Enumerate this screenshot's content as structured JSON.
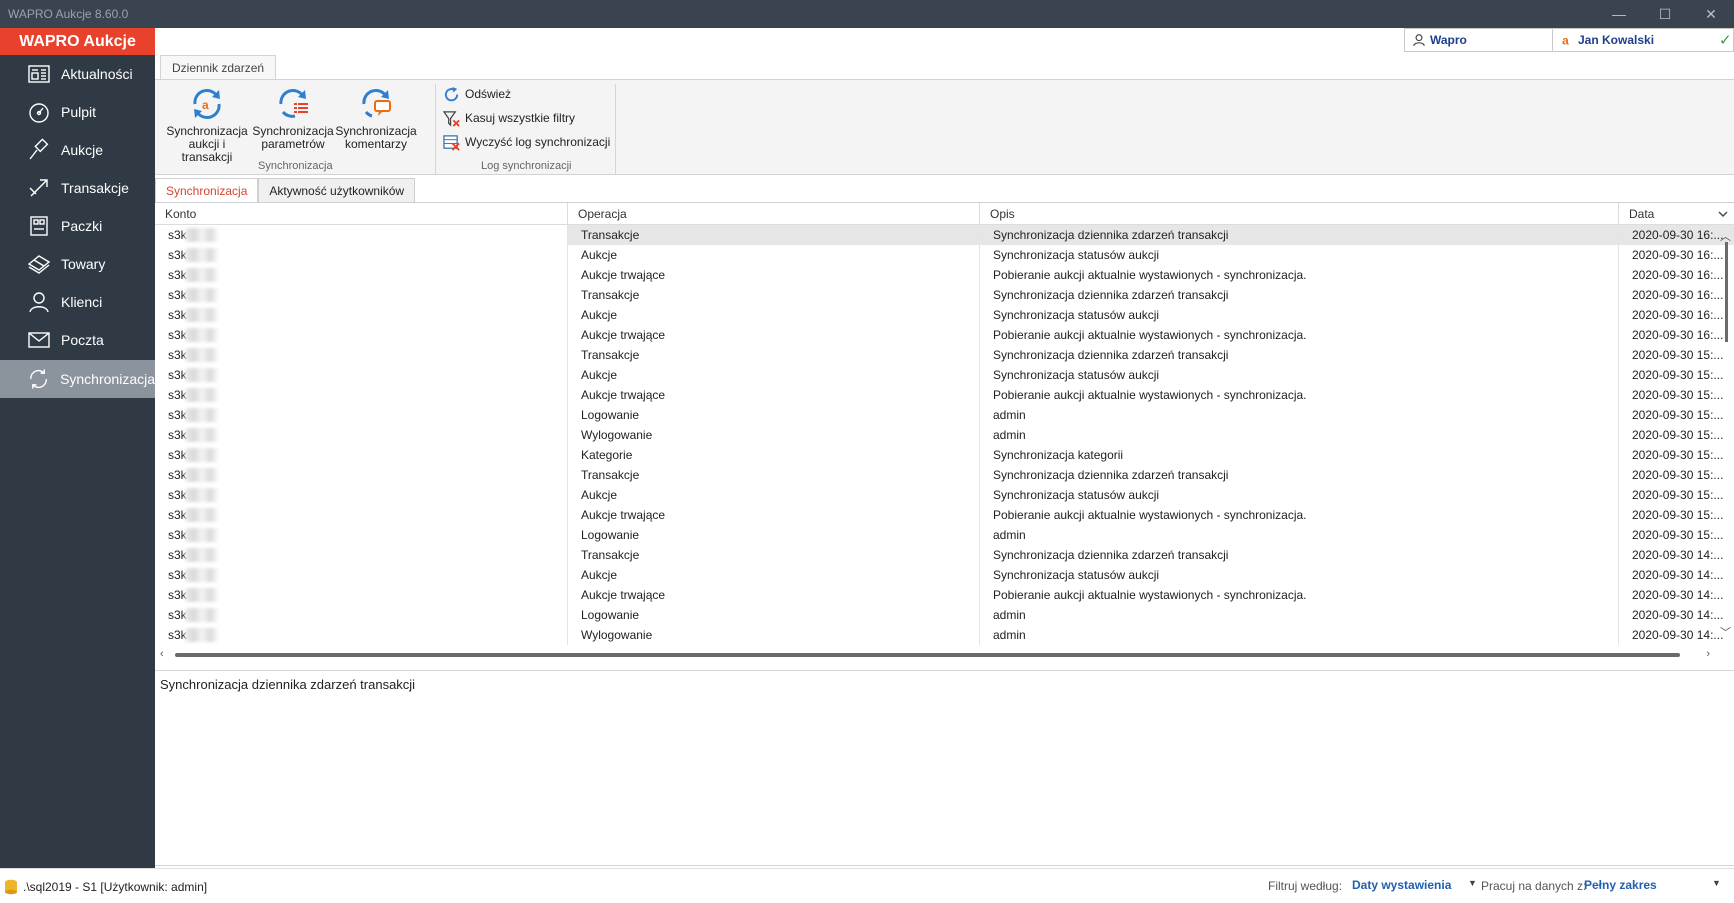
{
  "window": {
    "title": "WAPRO Aukcje 8.60.0",
    "minimize": "—",
    "maximize": "☐",
    "close": "✕"
  },
  "sidebar": {
    "brand": "WAPRO Aukcje",
    "items": [
      {
        "label": "Aktualności",
        "icon": "news-icon"
      },
      {
        "label": "Pulpit",
        "icon": "dashboard-icon"
      },
      {
        "label": "Aukcje",
        "icon": "gavel-icon"
      },
      {
        "label": "Transakcje",
        "icon": "transfer-icon"
      },
      {
        "label": "Paczki",
        "icon": "package-icon"
      },
      {
        "label": "Towary",
        "icon": "goods-icon"
      },
      {
        "label": "Klienci",
        "icon": "user-icon"
      },
      {
        "label": "Poczta",
        "icon": "mail-icon"
      },
      {
        "label": "Synchronizacja",
        "icon": "sync-icon",
        "active": true
      }
    ]
  },
  "userbar": {
    "company": "Wapro",
    "user": "Jan Kowalski",
    "status": "✓"
  },
  "ribbon": {
    "tab": "Dziennik zdarzeń",
    "groups": {
      "sync": {
        "label": "Synchronizacja",
        "buttons": [
          {
            "line1": "Synchronizacja",
            "line2": "aukcji i transakcji"
          },
          {
            "line1": "Synchronizacja",
            "line2": "parametrów"
          },
          {
            "line1": "Synchronizacja",
            "line2": "komentarzy"
          }
        ]
      },
      "log": {
        "label": "Log synchronizacji",
        "items": [
          "Odśwież",
          "Kasuj wszystkie filtry",
          "Wyczyść log synchronizacji"
        ]
      }
    }
  },
  "tabs": [
    "Synchronizacja",
    "Aktywność użytkowników"
  ],
  "grid": {
    "columns": [
      "Konto",
      "Operacja",
      "Opis",
      "Data"
    ],
    "rows": [
      [
        "s3k",
        "Transakcje",
        "Synchronizacja dziennika zdarzeń transakcji",
        "2020-09-30 16:..."
      ],
      [
        "s3k",
        "Aukcje",
        "Synchronizacja statusów aukcji",
        "2020-09-30 16:..."
      ],
      [
        "s3k",
        "Aukcje trwające",
        "Pobieranie aukcji aktualnie wystawionych - synchronizacja.",
        "2020-09-30 16:..."
      ],
      [
        "s3k",
        "Transakcje",
        "Synchronizacja dziennika zdarzeń transakcji",
        "2020-09-30 16:..."
      ],
      [
        "s3k",
        "Aukcje",
        "Synchronizacja statusów aukcji",
        "2020-09-30 16:..."
      ],
      [
        "s3k",
        "Aukcje trwające",
        "Pobieranie aukcji aktualnie wystawionych - synchronizacja.",
        "2020-09-30 16:..."
      ],
      [
        "s3k",
        "Transakcje",
        "Synchronizacja dziennika zdarzeń transakcji",
        "2020-09-30 15:..."
      ],
      [
        "s3k",
        "Aukcje",
        "Synchronizacja statusów aukcji",
        "2020-09-30 15:..."
      ],
      [
        "s3k",
        "Aukcje trwające",
        "Pobieranie aukcji aktualnie wystawionych - synchronizacja.",
        "2020-09-30 15:..."
      ],
      [
        "s3k",
        "Logowanie",
        "admin",
        "2020-09-30 15:..."
      ],
      [
        "s3k",
        "Wylogowanie",
        "admin",
        "2020-09-30 15:..."
      ],
      [
        "s3k",
        "Kategorie",
        "Synchronizacja kategorii",
        "2020-09-30 15:..."
      ],
      [
        "s3k",
        "Transakcje",
        "Synchronizacja dziennika zdarzeń transakcji",
        "2020-09-30 15:..."
      ],
      [
        "s3k",
        "Aukcje",
        "Synchronizacja statusów aukcji",
        "2020-09-30 15:..."
      ],
      [
        "s3k",
        "Aukcje trwające",
        "Pobieranie aukcji aktualnie wystawionych - synchronizacja.",
        "2020-09-30 15:..."
      ],
      [
        "s3k",
        "Logowanie",
        "admin",
        "2020-09-30 15:..."
      ],
      [
        "s3k",
        "Transakcje",
        "Synchronizacja dziennika zdarzeń transakcji",
        "2020-09-30 14:..."
      ],
      [
        "s3k",
        "Aukcje",
        "Synchronizacja statusów aukcji",
        "2020-09-30 14:..."
      ],
      [
        "s3k",
        "Aukcje trwające",
        "Pobieranie aukcji aktualnie wystawionych - synchronizacja.",
        "2020-09-30 14:..."
      ],
      [
        "s3k",
        "Logowanie",
        "admin",
        "2020-09-30 14:..."
      ],
      [
        "s3k",
        "Wylogowanie",
        "admin",
        "2020-09-30 14:..."
      ]
    ]
  },
  "detail": {
    "text": "Synchronizacja dziennika zdarzeń transakcji"
  },
  "statusbar": {
    "connection": ".\\sql2019 - S1 [Użytkownik: admin]",
    "filter_label": "Filtruj według:",
    "filter_value": "Daty wystawienia",
    "scope_label": "Pracuj na danych z:",
    "scope_value": "Pełny zakres"
  },
  "colors": {
    "brand": "#e8422d",
    "sidebar": "#2f3a45",
    "active_tab": "#d6452f",
    "link": "#1f5fb4"
  }
}
